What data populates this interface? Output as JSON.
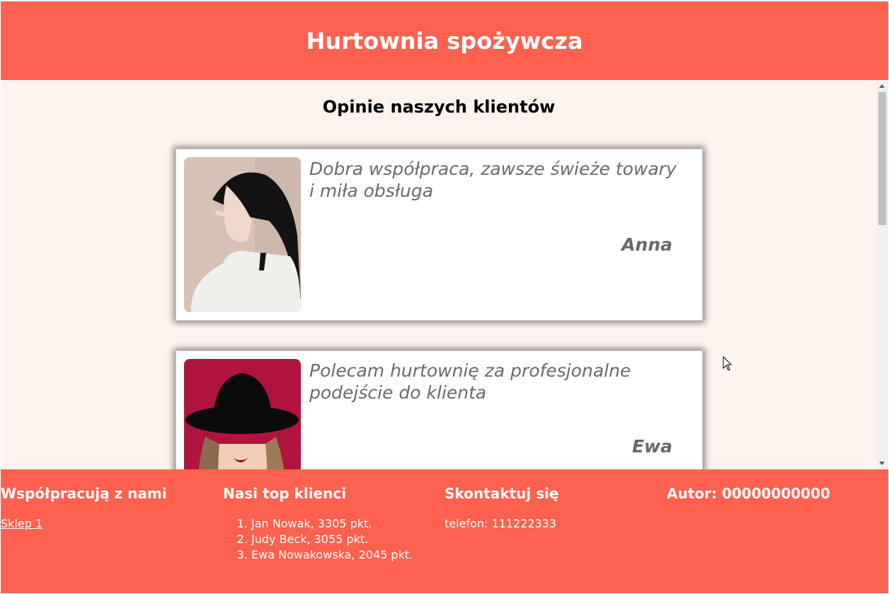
{
  "header": {
    "title": "Hurtownia spożywcza"
  },
  "main": {
    "title": "Opinie naszych klientów",
    "reviews": [
      {
        "quote": "Dobra współpraca, zawsze świeże towary i miła obsługa",
        "author": "Anna"
      },
      {
        "quote": "Polecam hurtownię za profesjonalne podejście do klienta",
        "author": "Ewa"
      }
    ]
  },
  "footer": {
    "partners": {
      "heading": "Współpracują z nami",
      "link": "Sklep 1"
    },
    "top_clients": {
      "heading": "Nasi top klienci",
      "items": [
        "Jan Nowak, 3305 pkt.",
        "Judy Beck, 3055 pkt.",
        "Ewa Nowakowska, 2045 pkt."
      ]
    },
    "contact": {
      "heading": "Skontaktuj się",
      "phone": "telefon: 111222333"
    },
    "author": {
      "heading": "Autor: 00000000000"
    }
  },
  "colors": {
    "accent": "#ff6150",
    "content_bg": "#fdf3ef",
    "quote_text": "#6a6a6a"
  }
}
